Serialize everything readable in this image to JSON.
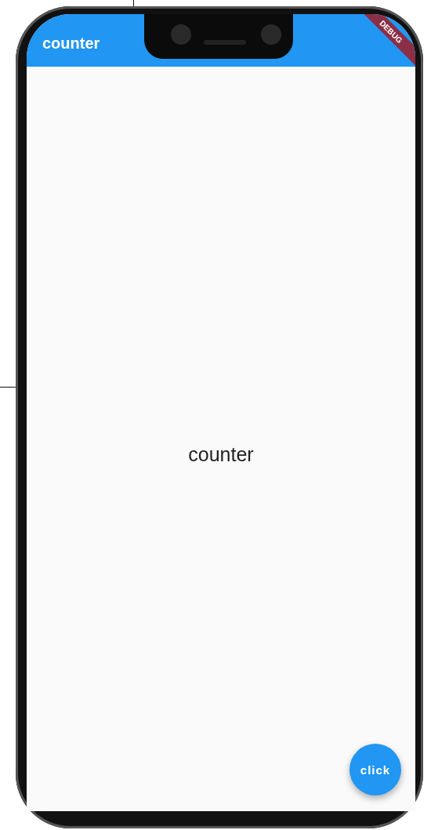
{
  "app_bar": {
    "title": "counter"
  },
  "debug_banner": {
    "label": "DEBUG"
  },
  "body": {
    "text": "counter"
  },
  "fab": {
    "label": "click"
  }
}
